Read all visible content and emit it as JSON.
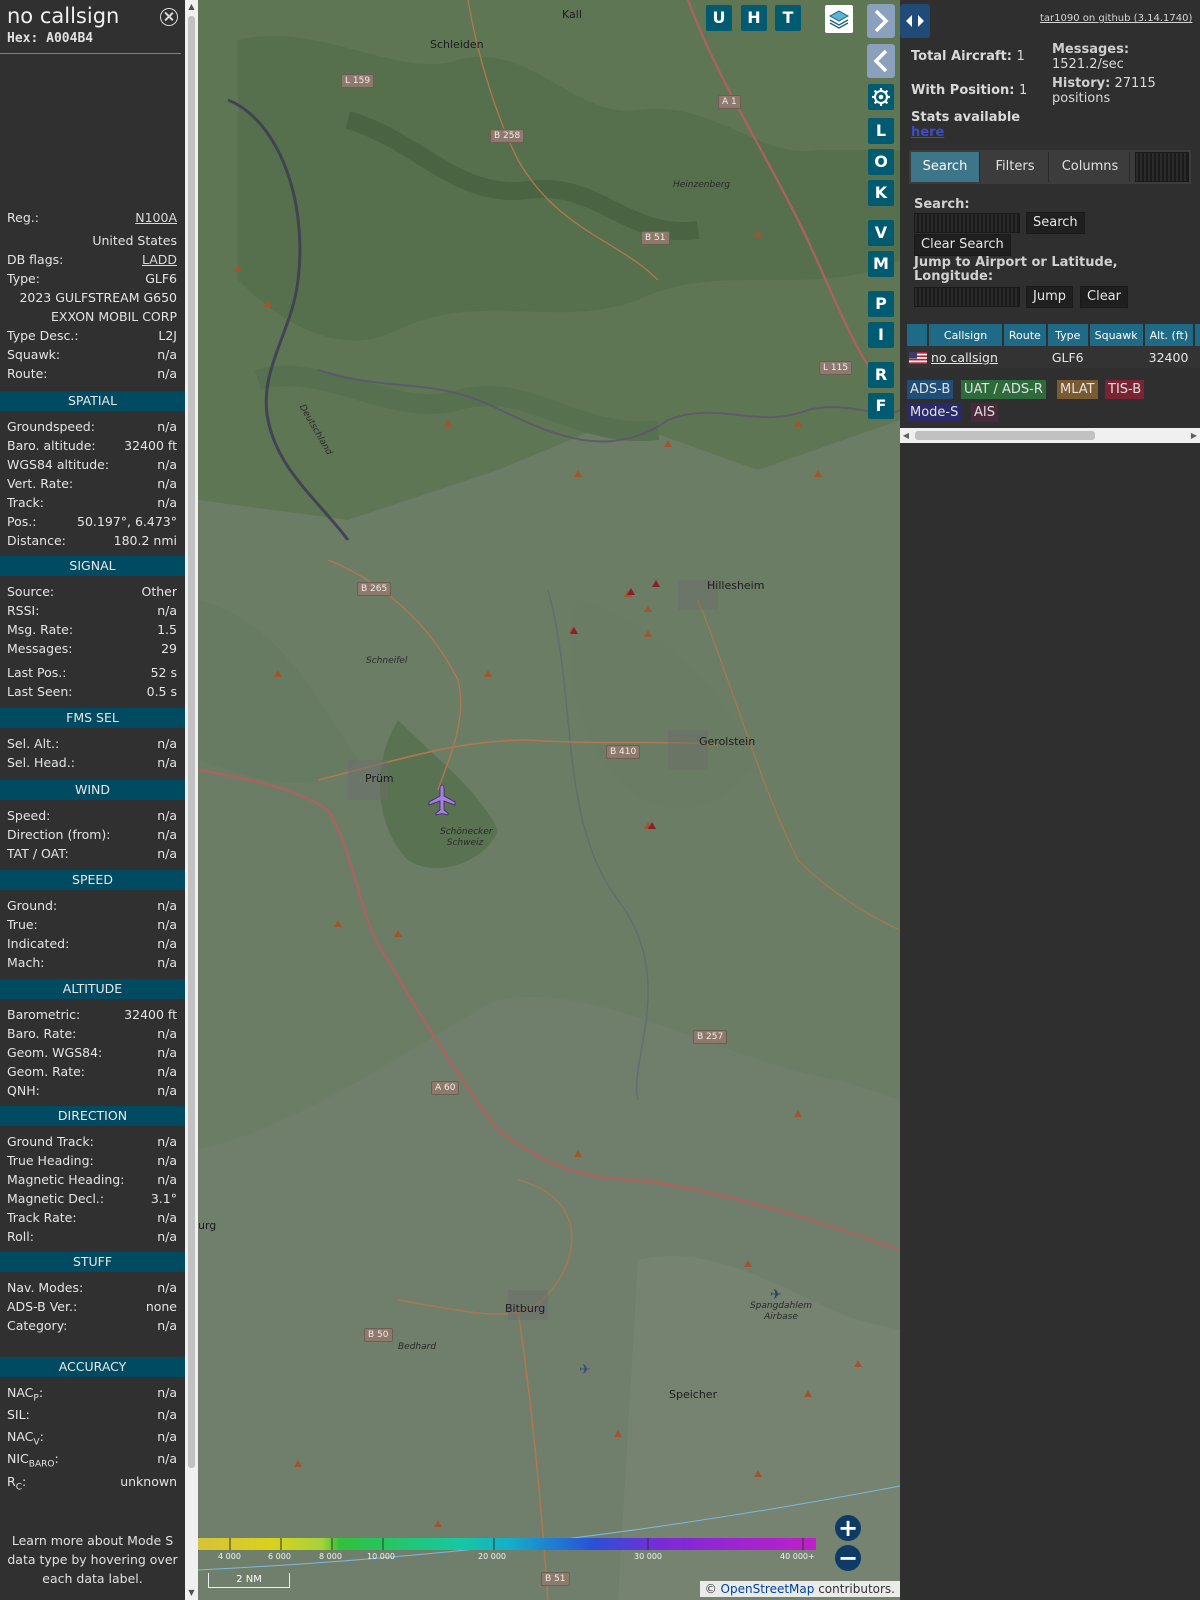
{
  "info": {
    "callsign": "no callsign",
    "hex_label": "Hex:",
    "hex": "A004B4",
    "rows_top": [
      {
        "k": "Reg.:",
        "v": "N100A"
      },
      {
        "k": "DB flags:",
        "v": "LADD"
      },
      {
        "k": "Type:",
        "v": "GLF6"
      },
      {
        "k": "Type Desc.:",
        "v": "L2J"
      },
      {
        "k": "Squawk:",
        "v": "n/a"
      },
      {
        "k": "Route:",
        "v": "n/a"
      }
    ],
    "country": "United States",
    "model": "2023 GULFSTREAM G650",
    "owner": "EXXON MOBIL CORP",
    "sections": {
      "spatial": "SPATIAL",
      "signal": "SIGNAL",
      "fms": "FMS SEL",
      "wind": "WIND",
      "speed": "SPEED",
      "altitude": "ALTITUDE",
      "direction": "DIRECTION",
      "stuff": "STUFF",
      "accuracy": "ACCURACY"
    },
    "spatial": [
      {
        "k": "Groundspeed:",
        "v": "n/a"
      },
      {
        "k": "Baro. altitude:",
        "v": "32400 ft"
      },
      {
        "k": "WGS84 altitude:",
        "v": "n/a"
      },
      {
        "k": "Vert. Rate:",
        "v": "n/a"
      },
      {
        "k": "Track:",
        "v": "n/a"
      },
      {
        "k": "Pos.:",
        "v": "50.197°, 6.473°"
      },
      {
        "k": "Distance:",
        "v": "180.2 nmi"
      }
    ],
    "signal": [
      {
        "k": "Source:",
        "v": "Other"
      },
      {
        "k": "RSSI:",
        "v": "n/a"
      },
      {
        "k": "Msg. Rate:",
        "v": "1.5"
      },
      {
        "k": "Messages:",
        "v": "29"
      },
      {
        "k": "Last Pos.:",
        "v": "52 s"
      },
      {
        "k": "Last Seen:",
        "v": "0.5 s"
      }
    ],
    "fms": [
      {
        "k": "Sel. Alt.:",
        "v": "n/a"
      },
      {
        "k": "Sel. Head.:",
        "v": "n/a"
      }
    ],
    "wind": [
      {
        "k": "Speed:",
        "v": "n/a"
      },
      {
        "k": "Direction (from):",
        "v": "n/a"
      },
      {
        "k": "TAT / OAT:",
        "v": "n/a"
      }
    ],
    "speed": [
      {
        "k": "Ground:",
        "v": "n/a"
      },
      {
        "k": "True:",
        "v": "n/a"
      },
      {
        "k": "Indicated:",
        "v": "n/a"
      },
      {
        "k": "Mach:",
        "v": "n/a"
      }
    ],
    "altitude": [
      {
        "k": "Barometric:",
        "v": "32400 ft"
      },
      {
        "k": "Baro. Rate:",
        "v": "n/a"
      },
      {
        "k": "Geom. WGS84:",
        "v": "n/a"
      },
      {
        "k": "Geom. Rate:",
        "v": "n/a"
      },
      {
        "k": "QNH:",
        "v": "n/a"
      }
    ],
    "direction": [
      {
        "k": "Ground Track:",
        "v": "n/a"
      },
      {
        "k": "True Heading:",
        "v": "n/a"
      },
      {
        "k": "Magnetic Heading:",
        "v": "n/a"
      },
      {
        "k": "Magnetic Decl.:",
        "v": "3.1°"
      },
      {
        "k": "Track Rate:",
        "v": "n/a"
      },
      {
        "k": "Roll:",
        "v": "n/a"
      }
    ],
    "stuff": [
      {
        "k": "Nav. Modes:",
        "v": "n/a"
      },
      {
        "k": "ADS-B Ver.:",
        "v": "none"
      },
      {
        "k": "Category:",
        "v": "n/a"
      }
    ],
    "accuracy": [
      {
        "k": "NAC",
        "sub": "P",
        "v": "n/a"
      },
      {
        "k": "SIL:",
        "sub": "",
        "v": "n/a"
      },
      {
        "k": "NAC",
        "sub": "V",
        "v": "n/a"
      },
      {
        "k": "NIC",
        "sub": "BARO",
        "v": "n/a"
      },
      {
        "k": "R",
        "sub": "C",
        "v": "unknown"
      }
    ],
    "learn_more": "Learn more about Mode S data type by hovering over each data label."
  },
  "map": {
    "places": [
      "Kall",
      "Schleiden",
      "Heinzenberg",
      "Hillesheim",
      "Schneifel",
      "Gerolstein",
      "Prüm",
      "Schönecker Schweiz",
      "Bitburg",
      "Spangdahlem Airbase",
      "Speicher",
      "Bedhard",
      "Deutschland",
      "urg"
    ],
    "road_labels": [
      "L 159",
      "B 258",
      "A 1",
      "B 51",
      "L 115",
      "B 265",
      "B 410",
      "B 257",
      "A 60",
      "B 50",
      "B 51"
    ],
    "buttons": {
      "u": "U",
      "h": "H",
      "t": "T",
      "l": "L",
      "o": "O",
      "k": "K",
      "v": "V",
      "m": "M",
      "p": "P",
      "i": "I",
      "r": "R",
      "f": "F"
    },
    "zoom_in": "+",
    "zoom_out": "−",
    "altitude_scale": [
      "4 000",
      "6 000",
      "8 000",
      "10 000",
      "20 000",
      "30 000",
      "40 000+"
    ],
    "scale_label": "2 NM",
    "attribution_prefix": "© ",
    "attribution_link": "OpenStreetMap",
    "attribution_suffix": " contributors."
  },
  "right": {
    "github": "tar1090 on github (3.14.1740)",
    "total_aircraft_label": "Total Aircraft:",
    "total_aircraft": "1",
    "with_position_label": "With Position:",
    "with_position": "1",
    "messages_label": "Messages:",
    "messages_value": "1521.2/sec",
    "history_label": "History:",
    "history_value": "27115",
    "history_unit": "positions",
    "stats_text": "Stats available",
    "stats_link": "here",
    "tabs": [
      "Search",
      "Filters",
      "Columns"
    ],
    "search_label": "Search:",
    "search_button": "Search",
    "clear_search_button": "Clear Search",
    "jump_label": "Jump to Airport or Latitude, Longitude:",
    "jump_button": "Jump",
    "clear_button": "Clear",
    "table": {
      "headers": [
        "Callsign",
        "Route",
        "Type",
        "Squawk",
        "Alt. (ft)",
        "S"
      ],
      "rows": [
        {
          "callsign": "no callsign",
          "route": "",
          "type": "GLF6",
          "squawk": "",
          "alt": "32400"
        }
      ]
    },
    "source_tags": [
      {
        "label": "ADS-B",
        "color": "#1f4e79"
      },
      {
        "label": "UAT / ADS-R",
        "color": "#2e6b3a"
      },
      {
        "label": "MLAT",
        "color": "#7a5a30"
      },
      {
        "label": "TIS-B",
        "color": "#7a2332"
      },
      {
        "label": "Mode-S",
        "color": "#2a2a6a"
      },
      {
        "label": "AIS",
        "color": "#4a2a3a"
      }
    ]
  }
}
